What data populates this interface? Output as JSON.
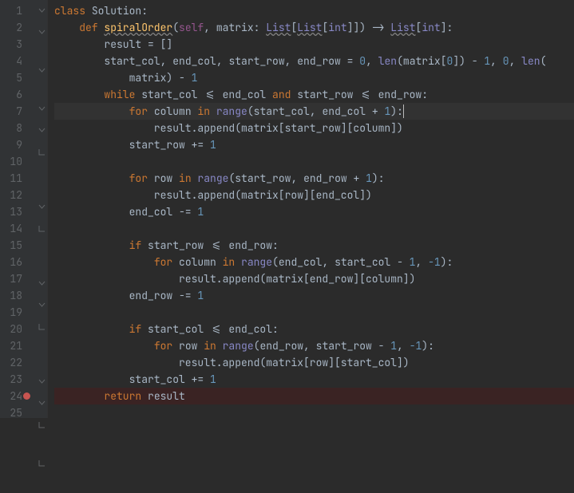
{
  "gutter": {
    "numbers": [
      "1",
      "2",
      "3",
      "4",
      "5",
      "6",
      "7",
      "8",
      "9",
      "10",
      "11",
      "12",
      "13",
      "14",
      "15",
      "16",
      "17",
      "18",
      "19",
      "20",
      "21",
      "22",
      "23",
      "24",
      "25"
    ],
    "breakpoints": [
      24
    ],
    "folds": {
      "1": "down",
      "2": "down",
      "4": "down",
      "6": "down",
      "7": "down",
      "8": "up",
      "11": "down",
      "12": "up",
      "15": "down",
      "16": "down",
      "17": "up",
      "20": "down",
      "21": "down",
      "22": "up",
      "24": "up"
    }
  },
  "highlighted_line": 7,
  "breakpoint_line": 24,
  "code_tokens": {
    "l1": [
      [
        "kw",
        "class "
      ],
      [
        "id",
        "Solution:"
      ]
    ],
    "l2": [
      [
        "id",
        "    "
      ],
      [
        "kw",
        "def "
      ],
      [
        "fn wavy",
        "spiralOrder"
      ],
      [
        "op",
        "("
      ],
      [
        "self",
        "self"
      ],
      [
        "op",
        ", matrix: "
      ],
      [
        "type wavy",
        "List"
      ],
      [
        "op",
        "["
      ],
      [
        "type wavy",
        "List"
      ],
      [
        "op",
        "["
      ],
      [
        "type",
        "int"
      ],
      [
        "op",
        "]]) -> "
      ],
      [
        "type wavy",
        "List"
      ],
      [
        "op",
        "["
      ],
      [
        "type",
        "int"
      ],
      [
        "op",
        "]:"
      ]
    ],
    "l3": [
      [
        "id",
        "        result = []"
      ]
    ],
    "l4": [
      [
        "id",
        "        start_col"
      ],
      [
        "op",
        ", "
      ],
      [
        "id",
        "end_col"
      ],
      [
        "op",
        ", "
      ],
      [
        "id",
        "start_row"
      ],
      [
        "op",
        ", "
      ],
      [
        "id",
        "end_row = "
      ],
      [
        "num",
        "0"
      ],
      [
        "op",
        ", "
      ],
      [
        "type",
        "len"
      ],
      [
        "op",
        "(matrix["
      ],
      [
        "num",
        "0"
      ],
      [
        "op",
        "]) - "
      ],
      [
        "num",
        "1"
      ],
      [
        "op",
        ", "
      ],
      [
        "num",
        "0"
      ],
      [
        "op",
        ", "
      ],
      [
        "type",
        "len"
      ],
      [
        "op",
        "("
      ]
    ],
    "l5": [
      [
        "id",
        "            matrix) - "
      ],
      [
        "num",
        "1"
      ]
    ],
    "l6": [
      [
        "id",
        "        "
      ],
      [
        "kw",
        "while "
      ],
      [
        "id",
        "start_col <= end_col "
      ],
      [
        "kw",
        "and "
      ],
      [
        "id",
        "start_row <= end_row:"
      ]
    ],
    "l7": [
      [
        "id",
        "            "
      ],
      [
        "kw",
        "for "
      ],
      [
        "id",
        "column "
      ],
      [
        "kw",
        "in "
      ],
      [
        "type",
        "range"
      ],
      [
        "op",
        "(start_col"
      ],
      [
        "op",
        ", "
      ],
      [
        "id",
        "end_col + "
      ],
      [
        "num",
        "1"
      ],
      [
        "op",
        "):"
      ]
    ],
    "l8": [
      [
        "id",
        "                result.append(matrix[start_row][column])"
      ]
    ],
    "l9": [
      [
        "id",
        "            start_row += "
      ],
      [
        "num",
        "1"
      ]
    ],
    "l10": [
      [
        "id",
        ""
      ]
    ],
    "l11": [
      [
        "id",
        "            "
      ],
      [
        "kw",
        "for "
      ],
      [
        "id",
        "row "
      ],
      [
        "kw",
        "in "
      ],
      [
        "type",
        "range"
      ],
      [
        "op",
        "(start_row"
      ],
      [
        "op",
        ", "
      ],
      [
        "id",
        "end_row + "
      ],
      [
        "num",
        "1"
      ],
      [
        "op",
        "):"
      ]
    ],
    "l12": [
      [
        "id",
        "                result.append(matrix[row][end_col])"
      ]
    ],
    "l13": [
      [
        "id",
        "            end_col -= "
      ],
      [
        "num",
        "1"
      ]
    ],
    "l14": [
      [
        "id",
        ""
      ]
    ],
    "l15": [
      [
        "id",
        "            "
      ],
      [
        "kw",
        "if "
      ],
      [
        "id",
        "start_row <= end_row:"
      ]
    ],
    "l16": [
      [
        "id",
        "                "
      ],
      [
        "kw",
        "for "
      ],
      [
        "id",
        "column "
      ],
      [
        "kw",
        "in "
      ],
      [
        "type",
        "range"
      ],
      [
        "op",
        "(end_col"
      ],
      [
        "op",
        ", "
      ],
      [
        "id",
        "start_col - "
      ],
      [
        "num",
        "1"
      ],
      [
        "op",
        ", "
      ],
      [
        "num",
        "-1"
      ],
      [
        "op",
        "):"
      ]
    ],
    "l17": [
      [
        "id",
        "                    result.append(matrix[end_row][column])"
      ]
    ],
    "l18": [
      [
        "id",
        "            end_row -= "
      ],
      [
        "num",
        "1"
      ]
    ],
    "l19": [
      [
        "id",
        ""
      ]
    ],
    "l20": [
      [
        "id",
        "            "
      ],
      [
        "kw",
        "if "
      ],
      [
        "id",
        "start_col <= end_col:"
      ]
    ],
    "l21": [
      [
        "id",
        "                "
      ],
      [
        "kw",
        "for "
      ],
      [
        "id",
        "row "
      ],
      [
        "kw",
        "in "
      ],
      [
        "type",
        "range"
      ],
      [
        "op",
        "(end_row"
      ],
      [
        "op",
        ", "
      ],
      [
        "id",
        "start_row - "
      ],
      [
        "num",
        "1"
      ],
      [
        "op",
        ", "
      ],
      [
        "num",
        "-1"
      ],
      [
        "op",
        "):"
      ]
    ],
    "l22": [
      [
        "id",
        "                    result.append(matrix[row][start_col])"
      ]
    ],
    "l23": [
      [
        "id",
        "            start_col += "
      ],
      [
        "num",
        "1"
      ]
    ],
    "l24": [
      [
        "id",
        "        "
      ],
      [
        "kw",
        "return "
      ],
      [
        "id",
        "result"
      ]
    ],
    "l25": [
      [
        "id",
        ""
      ]
    ]
  }
}
